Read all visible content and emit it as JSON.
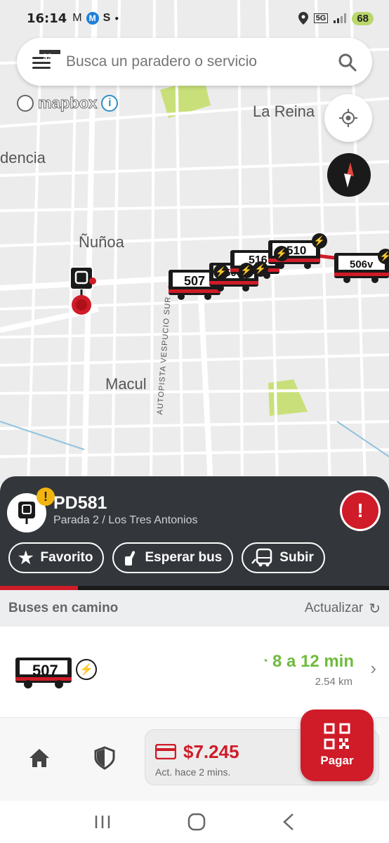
{
  "status_bar": {
    "time": "16:14",
    "notification_icons": [
      "gmail-icon",
      "metro-icon",
      "app-icon",
      "dot-icon"
    ],
    "signal": "5G",
    "battery": "68"
  },
  "search": {
    "placeholder": "Busca un paradero o servicio",
    "notification_badge": "99+"
  },
  "map": {
    "attribution": "mapbox",
    "labels": {
      "la_reina": "La Reina",
      "providencia_partial": "dencia",
      "nunoa": "Ñuñoa",
      "macul": "Macul",
      "highway": "AUTOPISTA VESPUCIO SUR"
    },
    "buses": [
      "507",
      "506v",
      "516",
      "510",
      "506v"
    ]
  },
  "stop": {
    "code": "PD581",
    "name": "Parada 2 / Los Tres Antonios",
    "actions": {
      "favorite": "Favorito",
      "wait": "Esperar bus",
      "board": "Subir"
    },
    "refresh_progress": 0.2
  },
  "buses_section": {
    "title": "Buses en camino",
    "refresh_label": "Actualizar",
    "items": [
      {
        "route": "507",
        "eta": "8 a 12 min",
        "distance": "2.54 km"
      }
    ]
  },
  "wallet": {
    "amount": "$7.245",
    "updated": "Act. hace 2 mins.",
    "pay_label": "Pagar"
  },
  "colors": {
    "brand_red": "#d01b28",
    "panel_dark": "#33373b",
    "eta_green": "#6fbb3f",
    "park_green": "#c9e07a"
  }
}
